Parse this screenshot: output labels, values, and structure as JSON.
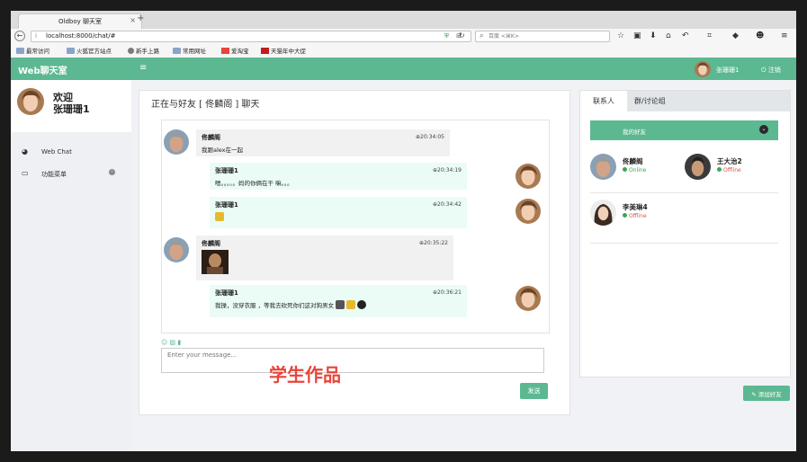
{
  "browser": {
    "tab_title": "Oldboy 聊天室",
    "close": "×",
    "new_tab": "+",
    "info": "i",
    "url": "localhost:8000/chat/#",
    "shield": "⛨",
    "qr": "⊞",
    "search_placeholder": "百度 <⌘K>",
    "bookmarks": [
      "最常访问",
      "火狐官方站点",
      "新手上路",
      "常用网址",
      "爱淘宝",
      "天猫年中大促"
    ]
  },
  "app": {
    "brand": "Web聊天室",
    "menu_icon": "≡",
    "user_name": "张珊珊1",
    "logout": "⏻ 注销",
    "accent_color": "#5cb891"
  },
  "sidebar": {
    "welcome": "欢迎",
    "user_name": "张珊珊1",
    "items": [
      {
        "label": "Web Chat",
        "icon": "dashboard-icon"
      },
      {
        "label": "功能菜单",
        "icon": "monitor-icon"
      }
    ]
  },
  "chat": {
    "title": "正在与好友 [ 佟麟阁 ] 聊天",
    "messages": [
      {
        "from": "佟麟阁",
        "time": "⊕20:34:05",
        "text": "我跟alex在一起",
        "direction": "in"
      },
      {
        "from": "张珊珊1",
        "time": "⊕20:34:19",
        "text": "嗯。。。。。妈的你俩在干 嘛。。。",
        "direction": "out"
      },
      {
        "from": "张珊珊1",
        "time": "⊕20:34:42",
        "text": "",
        "direction": "out"
      },
      {
        "from": "佟麟阁",
        "time": "⊕20:35:22",
        "text": "",
        "direction": "in"
      },
      {
        "from": "张珊珊1",
        "time": "⊕20:36:21",
        "text": "我操，没穿衣服 ，等我去砍死你们这对狗男女",
        "direction": "out"
      }
    ],
    "input_placeholder": "Enter your message...",
    "send_label": "发送",
    "watermark": "学生作品"
  },
  "contacts": {
    "tab_contacts": "联系人",
    "tab_groups": "群/讨论组",
    "group_name": "我的好友",
    "list": [
      {
        "name": "佟麟阁",
        "status": "Online",
        "status_color": "#3aa655"
      },
      {
        "name": "王大治2",
        "status": "Offline",
        "status_color": "#d9534f"
      },
      {
        "name": "李美琳4",
        "status": "Offline",
        "status_color": "#d9534f"
      }
    ],
    "add_friend": "✎ 添加好友"
  }
}
